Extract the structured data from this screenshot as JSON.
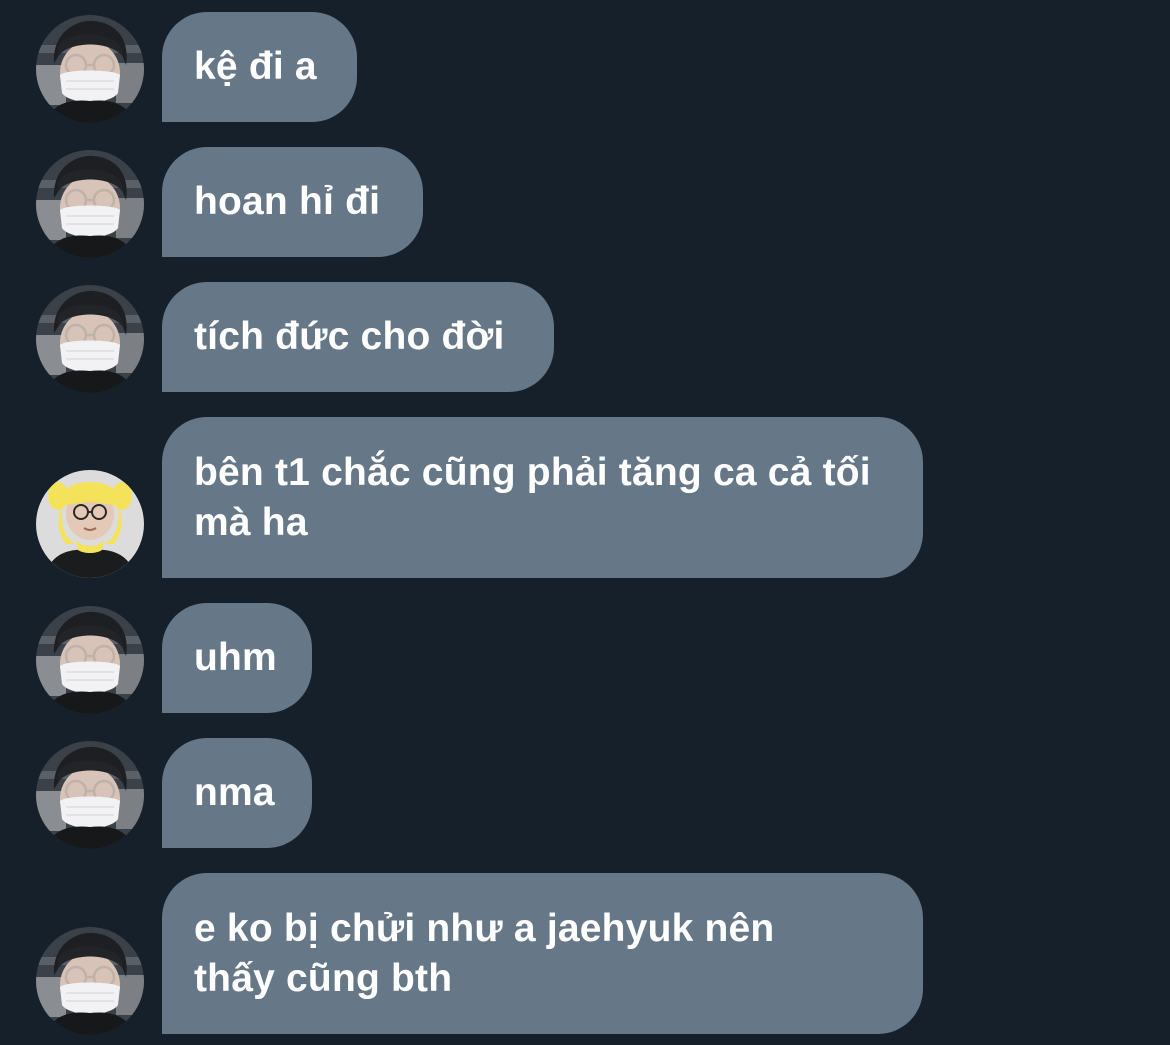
{
  "colors": {
    "background": "#16202b",
    "bubble": "#667788",
    "text": "#ffffff"
  },
  "messages": [
    {
      "sender_avatar": "masked-user-avatar",
      "text": "kệ đi a"
    },
    {
      "sender_avatar": "masked-user-avatar",
      "text": "hoan hỉ đi"
    },
    {
      "sender_avatar": "masked-user-avatar",
      "text": "tích đức cho đời"
    },
    {
      "sender_avatar": "yellow-hood-user-avatar",
      "text": "bên t1 chắc cũng phải tăng ca cả tối mà ha"
    },
    {
      "sender_avatar": "masked-user-avatar",
      "text": "uhm"
    },
    {
      "sender_avatar": "masked-user-avatar",
      "text": "nma"
    },
    {
      "sender_avatar": "masked-user-avatar",
      "text": "e ko bị chửi như a jaehyuk nên thấy cũng bth"
    }
  ]
}
